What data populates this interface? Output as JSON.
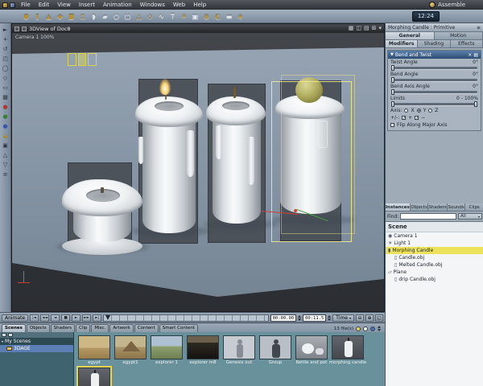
{
  "menubar": {
    "menus": [
      "File",
      "Edit",
      "View",
      "Insert",
      "Animation",
      "Windows",
      "Web",
      "Help"
    ],
    "room": "Assemble"
  },
  "toolbar": {
    "clock": "12:24",
    "icons": [
      "●",
      "▮",
      "▲",
      "◆",
      "■",
      "◎",
      "◗",
      "▰",
      "○",
      "▢",
      "△",
      "◇",
      "∿",
      "T",
      "☀",
      "▣",
      "◉",
      "◐",
      "▬",
      "◈"
    ]
  },
  "left_tools": {
    "icons": [
      "►",
      "+",
      "↺",
      "◰",
      "◯",
      "◇",
      "▭",
      "▦",
      "●",
      "●",
      "●",
      "◒",
      "▣",
      "△",
      "▽",
      "≡"
    ]
  },
  "viewport": {
    "title": "3DView of Doc8",
    "camera_label": "Camera 1 100%",
    "title_icons": [
      "▦",
      "◫",
      "▤",
      "⊞",
      "▾"
    ]
  },
  "right_panel": {
    "header": "Morphing Candle : Primitive",
    "header_menu_icon": "≡",
    "tabs_top": [
      "General",
      "Motion"
    ],
    "tabs_sub": [
      "Modifiers",
      "Shading",
      "Effects"
    ],
    "modifier": {
      "collapse_icon": "▼",
      "title": "Bend and Twist",
      "close_icon": "×",
      "menu_icon": "▤",
      "params": [
        {
          "label": "Twist Angle",
          "value": "0°"
        },
        {
          "label": "Bend Angle",
          "value": "0°"
        },
        {
          "label": "Bend Axis Angle",
          "value": "0°"
        }
      ],
      "limits": {
        "label": "Limits",
        "value": "0 - 100%"
      },
      "axis": {
        "label": "Axis:",
        "options": [
          "X",
          "Y",
          "Z"
        ]
      },
      "pm": {
        "label": "+/-:",
        "options": [
          "+",
          "−"
        ]
      },
      "flip_label": "Flip Along Major Axis"
    },
    "lower_tabs": [
      "Instances",
      "Objects",
      "Shaders",
      "Sounds",
      "Clips"
    ],
    "find_label": "Find:",
    "filter_value": "All",
    "filter_arrow": "▾",
    "scene_header": "Scene",
    "scene_items": [
      {
        "icon": "◉",
        "label": "Camera 1"
      },
      {
        "icon": "☀",
        "label": "Light 1"
      },
      {
        "icon": "▮",
        "label": "Morphing Candle"
      },
      {
        "icon": "▯",
        "label": "Candle.obj"
      },
      {
        "icon": "▯",
        "label": "Melted Candle.obj"
      },
      {
        "icon": "▱",
        "label": "Plane"
      },
      {
        "icon": "▯",
        "label": "drip Candle.obj"
      }
    ]
  },
  "timeline": {
    "animate_label": "Animate",
    "buttons": [
      "|◄",
      "◄◄",
      "◄",
      "■",
      "►",
      "►►",
      "►|"
    ],
    "time_current": "00:00.00",
    "time_end": "00:11.5",
    "mode_label": "Time",
    "mode_arrow": "▾",
    "zoom_icons": [
      "⊖",
      "⊕",
      "◱"
    ]
  },
  "browser": {
    "tabs": [
      "Scenes",
      "Objects",
      "Shaders",
      "Clip",
      "Misc.",
      "Artwork",
      "Content",
      "Smart Content"
    ],
    "file_count": "13 file(s)",
    "tree_root": "My Scenes",
    "tree_root_arrow": "▾",
    "tree_item": "3DAGE",
    "thumbs": [
      {
        "label": "egypt"
      },
      {
        "label": "egypt1"
      },
      {
        "label": "explorer 1"
      },
      {
        "label": "explorer m8"
      },
      {
        "label": "Genesis out"
      },
      {
        "label": "Group"
      },
      {
        "label": "Kettle and pot"
      },
      {
        "label": "morphing candle"
      },
      {
        "label": ""
      }
    ]
  }
}
